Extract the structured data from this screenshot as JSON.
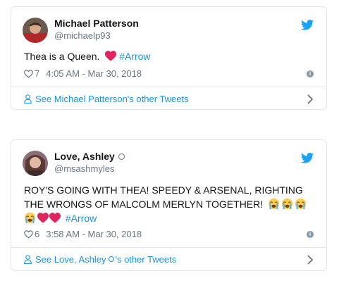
{
  "tweets": [
    {
      "author_name": "Michael Patterson",
      "author_handle": "@michaelp93",
      "body_text": "Thea is a Queen.",
      "hashtag": "#Arrow",
      "like_count": "7",
      "timestamp": "4:05 AM - Mar 30, 2018",
      "footer_link": "See Michael Patterson's other Tweets"
    },
    {
      "author_name": "Love, Ashley",
      "author_handle": "@msashmyles",
      "body_line1": "ROY'S GOING WITH THEA! SPEEDY & ARSENAL, RIGHTING",
      "body_line2": "THE WRONGS OF MALCOLM MERLYN TOGETHER!",
      "hashtag": "#Arrow",
      "like_count": "6",
      "timestamp": "3:58 AM - Mar 30, 2018",
      "footer_prefix": "See Love, Ashley",
      "footer_suffix": "'s other Tweets"
    }
  ],
  "icons": {
    "brand": "twitter-bird-icon",
    "like": "heart-outline-icon",
    "info": "info-icon",
    "user": "person-icon",
    "chevron": "chevron-right-icon"
  },
  "colors": {
    "link": "#1b95e0",
    "muted": "#657786",
    "border": "#e1e8ed",
    "heart": "#e0245e"
  }
}
